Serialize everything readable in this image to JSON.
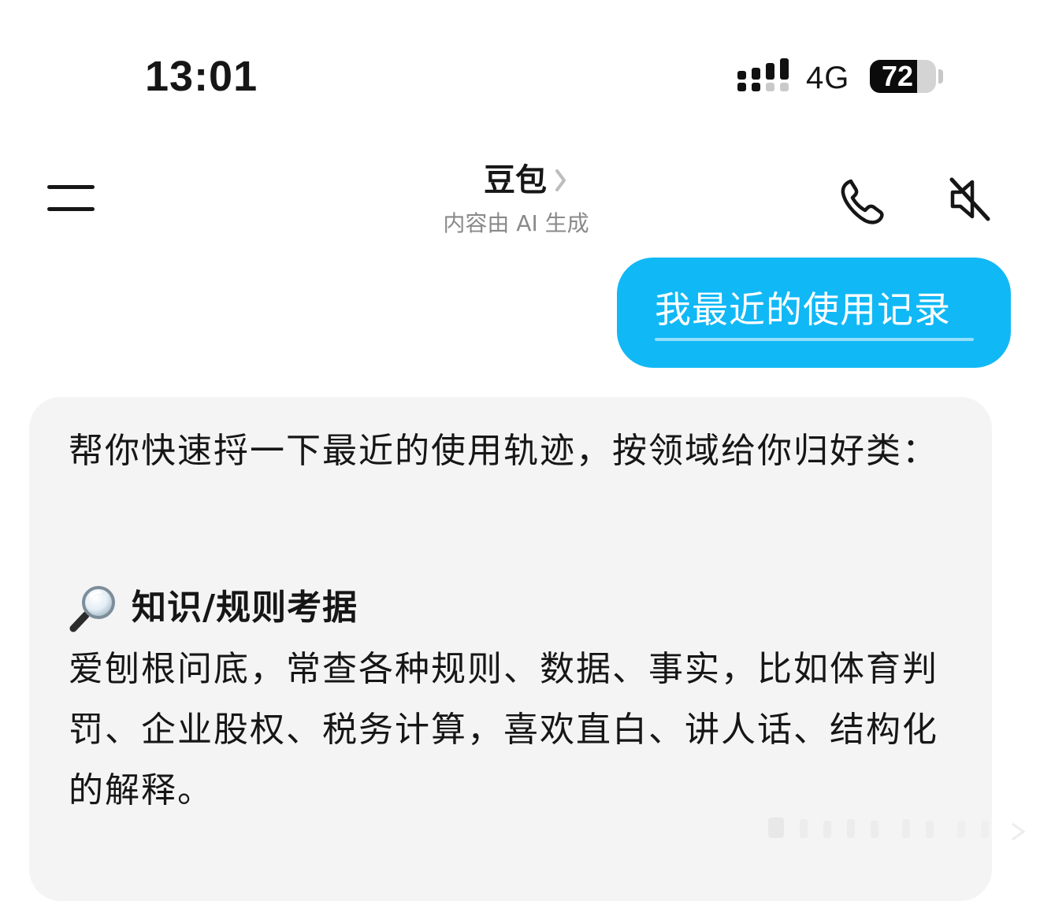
{
  "status_bar": {
    "time": "13:01",
    "network": "4G",
    "battery_level": "72",
    "battery_fraction": 0.72,
    "signal_icon": "cellular-signal-icon"
  },
  "header": {
    "menu_icon": "menu-icon",
    "title": "豆包",
    "title_chevron_icon": "chevron-right-icon",
    "subtitle": "内容由 AI 生成",
    "phone_icon": "phone-icon",
    "speaker_icon": "speaker-muted-icon"
  },
  "conversation": {
    "user_message": "我最近的使用记录",
    "reply": {
      "intro": "帮你快速捋一下最近的使用轨迹，按领域给你归好类：",
      "section_icon": "magnifier-icon",
      "section_title": "知识/规则考据",
      "section_body": "爱刨根问底，常查各种规则、数据、事实，比如体育判罚、企业股权、税务计算，喜欢直白、讲人话、结构化的解释。"
    }
  },
  "colors": {
    "user_bubble": "#11b8f6",
    "reply_card": "#f4f4f5",
    "text": "#161616",
    "subtitle": "#8a8a8a"
  }
}
